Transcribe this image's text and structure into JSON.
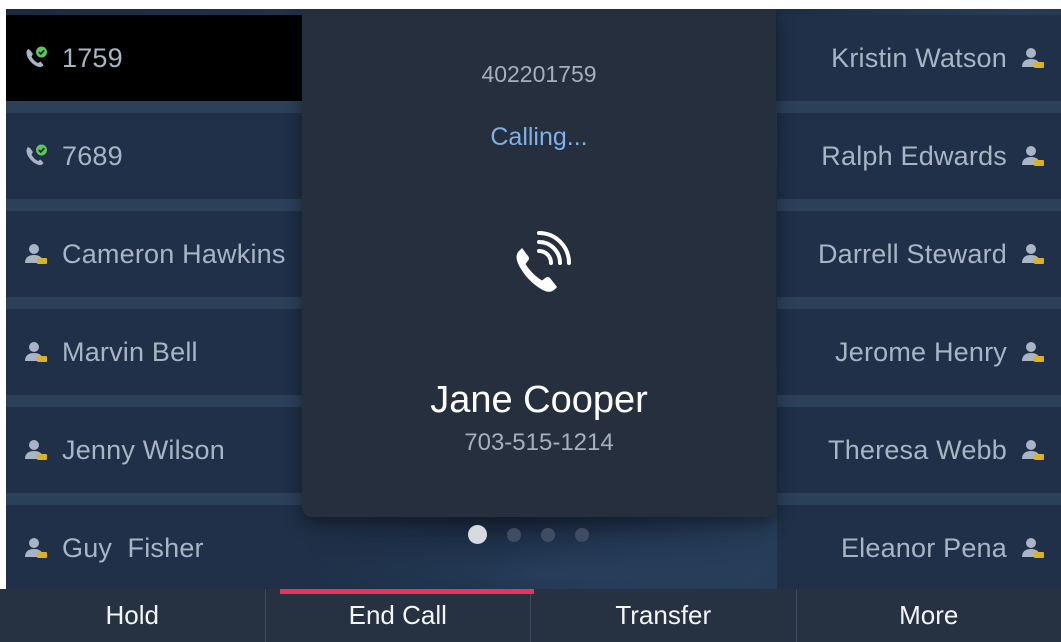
{
  "colors": {
    "accent": "#e8335a",
    "status_text": "#7fb0e6",
    "presence_green": "#5cc85a",
    "busy_amber": "#d8b22c"
  },
  "left_tiles": [
    {
      "label": "1759",
      "icon": "phone-check-icon",
      "active": true
    },
    {
      "label": "7689",
      "icon": "phone-check-icon",
      "active": false
    },
    {
      "label": "Cameron Hawkins",
      "icon": "contact-person-icon",
      "active": false
    },
    {
      "label": "Marvin Bell",
      "icon": "contact-person-icon",
      "active": false
    },
    {
      "label": "Jenny Wilson",
      "icon": "contact-person-icon",
      "active": false
    },
    {
      "label": "Guy  Fisher",
      "icon": "contact-person-icon",
      "active": false
    }
  ],
  "right_tiles": [
    {
      "label": "Kristin Watson",
      "icon": "contact-person-icon"
    },
    {
      "label": "Ralph Edwards",
      "icon": "contact-person-icon"
    },
    {
      "label": "Darrell Steward",
      "icon": "contact-person-icon"
    },
    {
      "label": "Jerome Henry",
      "icon": "contact-person-icon"
    },
    {
      "label": "Theresa Webb",
      "icon": "contact-person-icon"
    },
    {
      "label": "Eleanor Pena",
      "icon": "contact-person-icon"
    }
  ],
  "call": {
    "dialed_number": "402201759",
    "status": "Calling...",
    "icon": "phone-ringing-icon",
    "contact_name": "Jane Cooper",
    "contact_number": "703-515-1214"
  },
  "pager": {
    "pages": 4,
    "current": 1
  },
  "softkeys": [
    {
      "label": "Hold"
    },
    {
      "label": "End Call",
      "selected": true
    },
    {
      "label": "Transfer"
    },
    {
      "label": "More"
    }
  ]
}
